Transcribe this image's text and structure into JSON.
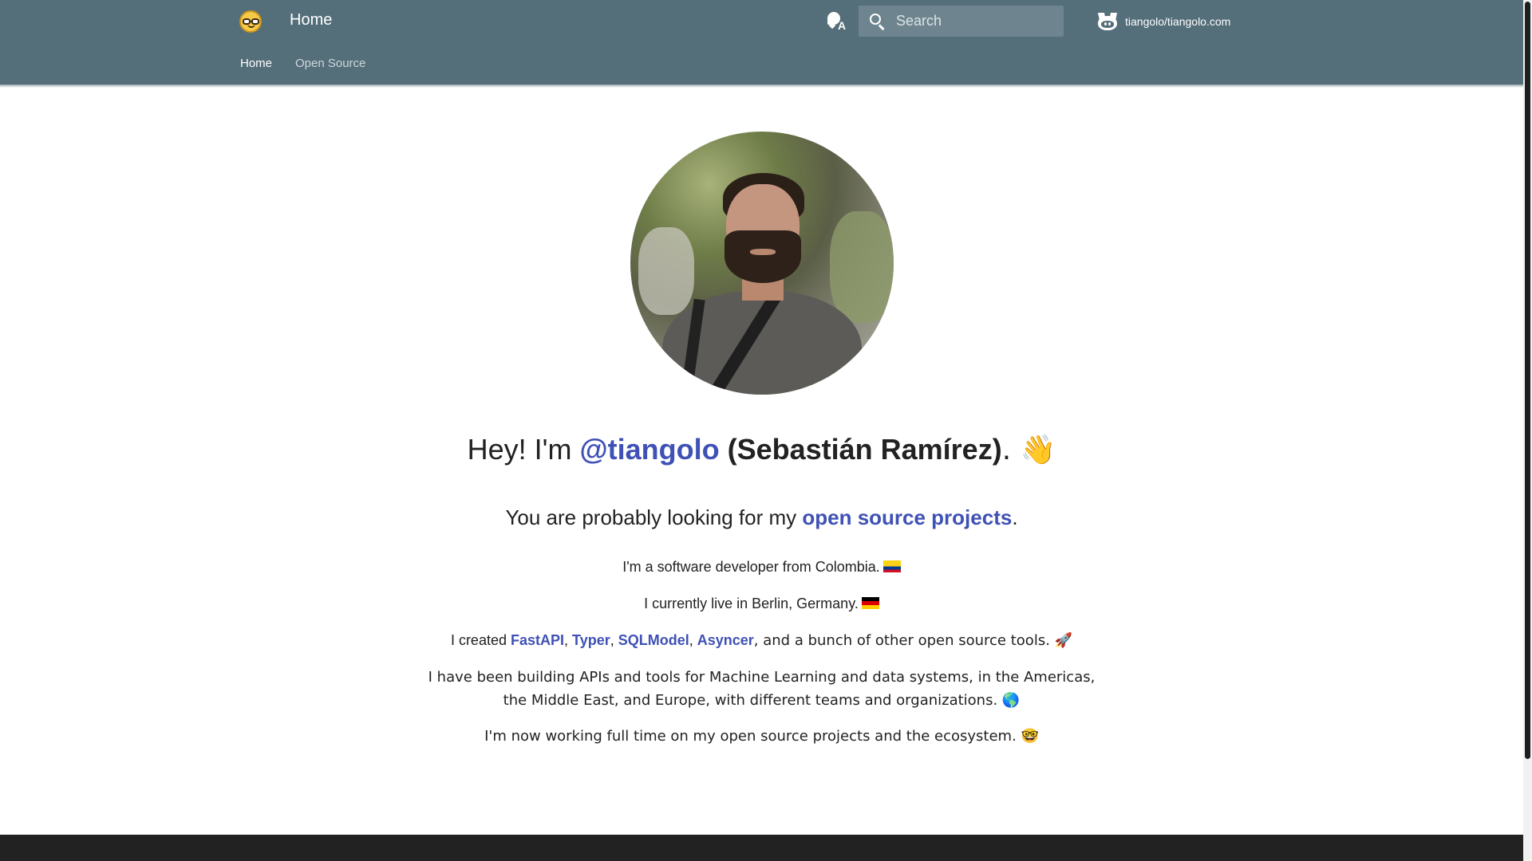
{
  "header": {
    "logo_icon": "nerd-face-emoji-logo",
    "title": "Home",
    "language_icon": "translate-icon",
    "search": {
      "placeholder": "Search",
      "value": ""
    },
    "repo": {
      "icon": "github-icon",
      "label": "tiangolo/tiangolo.com"
    },
    "tabs": [
      {
        "label": "Home",
        "active": true
      },
      {
        "label": "Open Source",
        "active": false
      }
    ],
    "colors": {
      "primary": "#546e7a",
      "link": "#3f51b5"
    }
  },
  "content": {
    "greeting": {
      "prefix": "Hey! I'm ",
      "handle": "@tiangolo",
      "name": "(Sebastián Ramírez)",
      "suffix": ". 👋"
    },
    "subtitle": {
      "prefix": "You are probably looking for my ",
      "link": "open source projects",
      "suffix": "."
    },
    "p1": {
      "text": "I'm a software developer from Colombia."
    },
    "p2": {
      "text": "I currently live in Berlin, Germany."
    },
    "p3": {
      "prefix": "I created ",
      "links": [
        "FastAPI",
        "Typer",
        "SQLModel",
        "Asyncer"
      ],
      "suffix": ", and a bunch of other open source tools. 🚀"
    },
    "p4": {
      "text": "I have been building APIs and tools for Machine Learning and data systems, in the Americas, the Middle East, and Europe, with different teams and organizations. 🌎"
    },
    "p5": {
      "text": "I'm now working full time on my open source projects and the ecosystem. 🤓"
    }
  }
}
